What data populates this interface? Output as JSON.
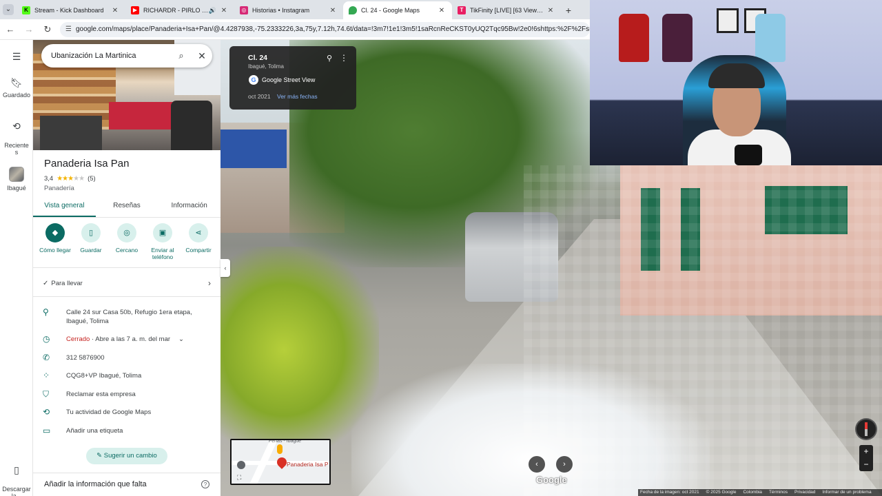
{
  "browser": {
    "tabs": [
      {
        "title": "Stream - Kick Dashboard",
        "favicon_color": "#53fc18",
        "favicon_glyph": "K",
        "active": false
      },
      {
        "title": "RICHARDR - PIRLO (Visualiz",
        "favicon_color": "#ff0000",
        "favicon_glyph": "▶",
        "active": false,
        "audio": true
      },
      {
        "title": "Historias • Instagram",
        "favicon_color": "#d62976",
        "favicon_glyph": "◎",
        "active": false
      },
      {
        "title": "Cl. 24 - Google Maps",
        "favicon_color": "#34a853",
        "favicon_glyph": "●",
        "active": true
      },
      {
        "title": "TikFinity [LIVE] [63 Viewers]",
        "favicon_color": "#e91e63",
        "favicon_glyph": "T",
        "active": false
      }
    ],
    "url": "google.com/maps/place/Panaderia+Isa+Pan/@4.4287938,-75.2333226,3a,75y,7.12h,74.6t/data=!3m7!1e1!3m5!1saRcnReCKST0yUQ2Tqc95Bw!2e0!6shttps:%2F%2Fstreetviewpixels-pa.g"
  },
  "rail": {
    "saved": "Guardado",
    "recents": "Reciente\ns",
    "ibague": "Ibagué",
    "download": "Descargar\nla..."
  },
  "search": {
    "value": "Ubanización La Martinica"
  },
  "place": {
    "name": "Panaderia Isa Pan",
    "rating": "3,4",
    "reviews": "(5)",
    "stars_filled": 3.5,
    "category": "Panadería",
    "tabs": [
      "Vista general",
      "Reseñas",
      "Información"
    ],
    "actions": [
      {
        "label": "Cómo llegar",
        "icon": "directions-icon"
      },
      {
        "label": "Guardar",
        "icon": "bookmark-icon"
      },
      {
        "label": "Cercano",
        "icon": "nearby-icon"
      },
      {
        "label": "Enviar al teléfono",
        "icon": "phone-send-icon"
      },
      {
        "label": "Compartir",
        "icon": "share-icon"
      }
    ],
    "takeaway": "Para llevar",
    "address": "Calle 24 sur Casa 50b, Refugio 1era etapa, Ibagué, Tolima",
    "status_closed": "Cerrado",
    "status_rest": " · Abre a las 7 a. m. del mar",
    "phone": "312 5876900",
    "plus_code": "CQG8+VP Ibagué, Tolima",
    "claim": "Reclamar esta empresa",
    "activity": "Tu actividad de Google Maps",
    "label": "Añadir una etiqueta",
    "suggest": "Sugerir un cambio",
    "missing": "Añadir la información que falta"
  },
  "streetview": {
    "street": "Cl. 24",
    "city": "Ibagué, Tolima",
    "brand": "Google Street View",
    "date": "oct 2021",
    "more_dates": "Ver más fechas",
    "minimap_top": "Ferias - Ibagué",
    "minimap_place": "Panaderia Isa P",
    "google_watermark": "Google"
  },
  "footer": {
    "items": [
      "Fecha de la imagen: oct 2021",
      "© 2025 Google",
      "Colombia",
      "Términos",
      "Privacidad",
      "Informar de un problema"
    ]
  },
  "colors": {
    "accent": "#0b6b63",
    "closed": "#c5221f",
    "star": "#f4b400"
  }
}
